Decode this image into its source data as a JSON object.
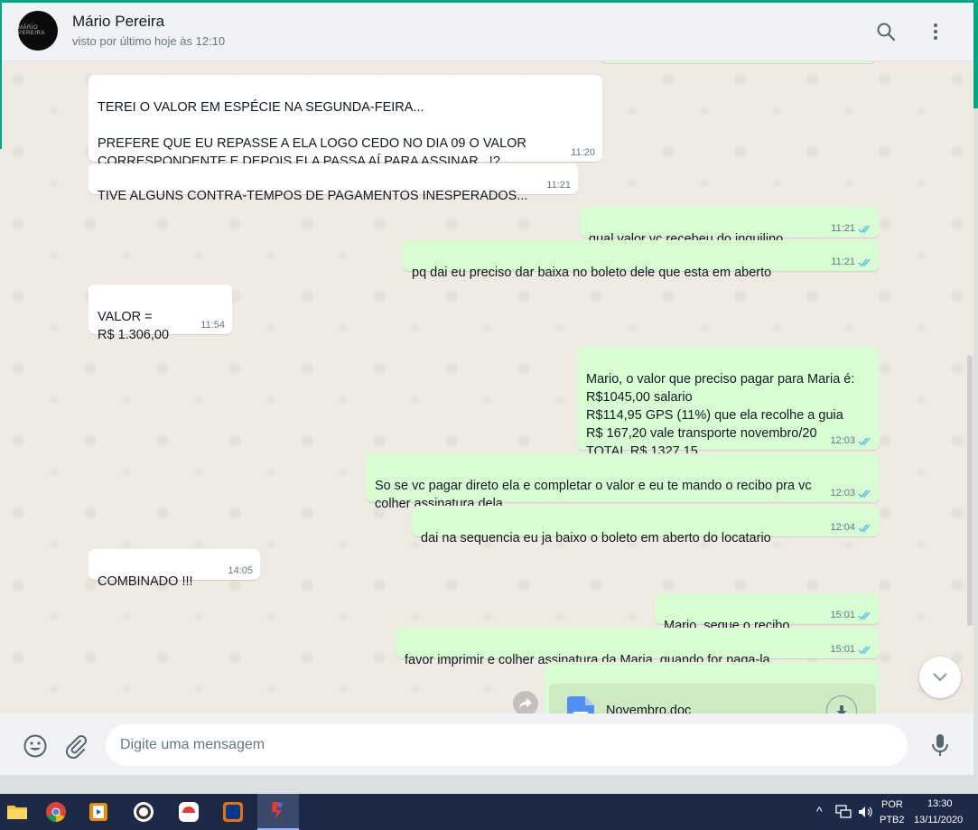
{
  "header": {
    "avatar_text": "MÁRIO PEREIRA",
    "contact_name": "Mário Pereira",
    "last_seen": "visto por último hoje às 12:10"
  },
  "messages": [
    {
      "direction": "in",
      "text": "TEREI O VALOR EM ESPÉCIE NA SEGUNDA-FEIRA...\n\nPREFERE QUE EU REPASSE A ELA LOGO CEDO NO DIA 09 O VALOR\nCORRESPONDENTE E DEPOIS ELA PASSA AÍ PARA ASSINAR...!?",
      "time": "11:20"
    },
    {
      "direction": "in",
      "text": "TIVE ALGUNS CONTRA-TEMPOS DE PAGAMENTOS INESPERADOS...",
      "time": "11:21"
    },
    {
      "direction": "out",
      "text": "qual valor vc recebeu do inquilino",
      "time": "11:21"
    },
    {
      "direction": "out",
      "text": "pq dai eu preciso dar baixa no boleto dele que esta em aberto",
      "time": "11:21"
    },
    {
      "direction": "in",
      "text": "VALOR =\nR$ 1.306,00",
      "time": "11:54"
    },
    {
      "direction": "out",
      "text": "Mario, o valor que preciso pagar para Maria é:\nR$1045,00 salario\nR$114,95 GPS (11%) que ela recolhe a guia\nR$ 167,20 vale transporte novembro/20\nTOTAL R$ 1327,15",
      "time": "12:03"
    },
    {
      "direction": "out",
      "text": "So se vc pagar direto ela e completar o valor e eu te mando o recibo pra vc\ncolher assinatura dela",
      "time": "12:03"
    },
    {
      "direction": "out",
      "text": "dai na sequencia eu ja baixo o boleto em aberto do locatario",
      "time": "12:04"
    },
    {
      "direction": "in",
      "text": "COMBINADO !!!",
      "time": "14:05"
    },
    {
      "direction": "out",
      "text": "Mario, segue o recibo",
      "time": "15:01"
    },
    {
      "direction": "out",
      "text": "favor imprimir e colher assinatura da Maria, quando for paga-la",
      "time": "15:01"
    }
  ],
  "file_message": {
    "file_name": "Novembro.doc"
  },
  "composer": {
    "placeholder": "Digite uma mensagem"
  },
  "taskbar": {
    "apps": [
      "file-explorer",
      "chrome",
      "media-player",
      "whatsapp",
      "app-red",
      "app-itau",
      "app-active"
    ],
    "lang_top": "POR",
    "lang_bottom": "PTB2",
    "time": "13:30",
    "date": "13/11/2020"
  },
  "colors": {
    "accent": "#00a884",
    "incoming_bubble": "#ffffff",
    "outgoing_bubble": "#d9fdd3",
    "read_tick": "#53bdeb"
  }
}
